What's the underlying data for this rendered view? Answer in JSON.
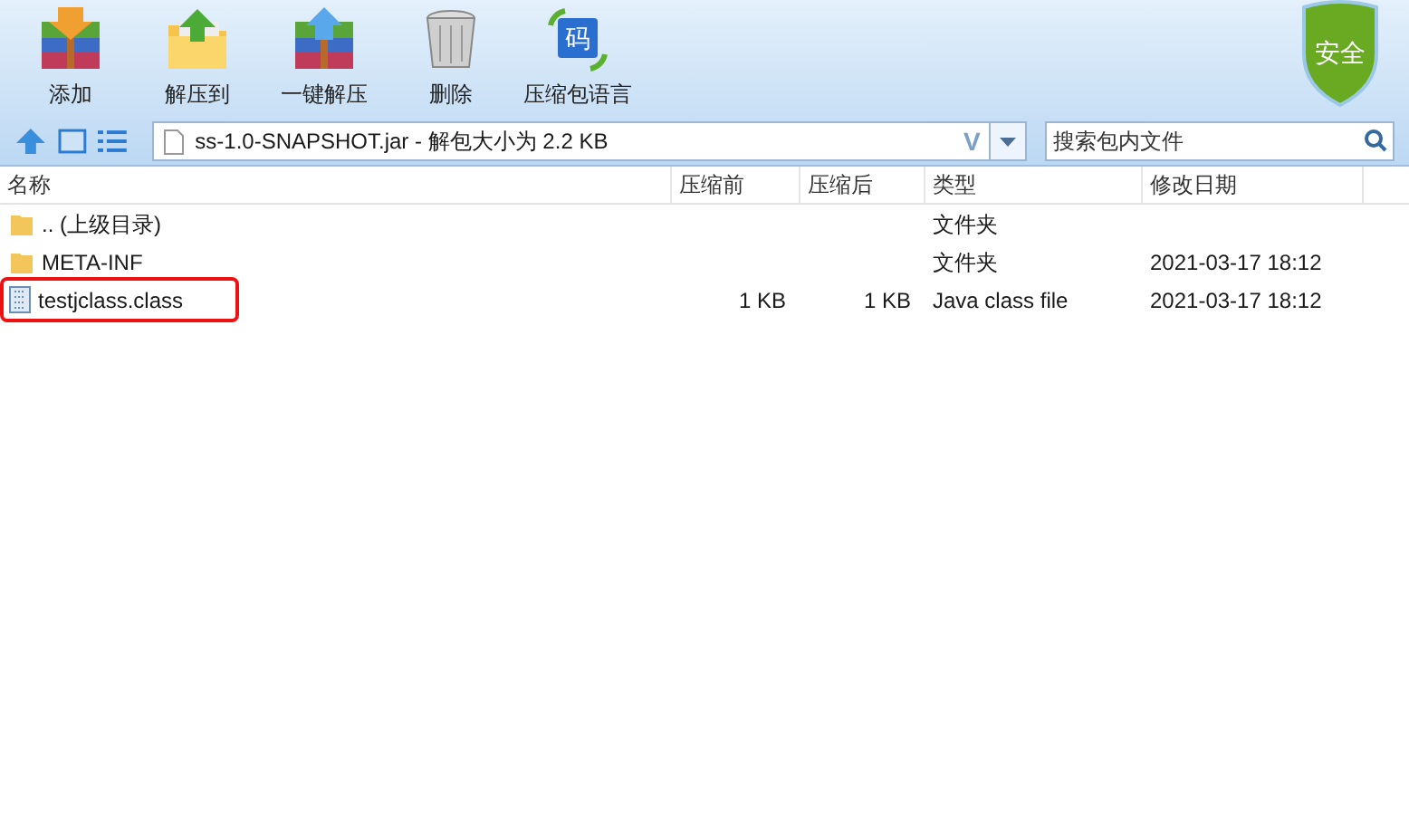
{
  "toolbar": [
    {
      "kind": "add",
      "label": "添加"
    },
    {
      "kind": "extract",
      "label": "解压到"
    },
    {
      "kind": "oneclick",
      "label": "一键解压"
    },
    {
      "kind": "delete",
      "label": "删除"
    },
    {
      "kind": "language",
      "label": "压缩包语言",
      "icon_text": "码"
    }
  ],
  "security_badge": "安全",
  "address": {
    "value": "ss-1.0-SNAPSHOT.jar - 解包大小为 2.2 KB",
    "arrow": "V"
  },
  "search": {
    "placeholder": "搜索包内文件"
  },
  "table": {
    "columns": [
      "名称",
      "压缩前",
      "压缩后",
      "类型",
      "修改日期"
    ],
    "rows": [
      {
        "kind": "folder",
        "name": ".. (上级目录)",
        "size": "",
        "packed": "",
        "type": "文件夹",
        "date": "",
        "highlighted": false
      },
      {
        "kind": "folder",
        "name": "META-INF",
        "size": "",
        "packed": "",
        "type": "文件夹",
        "date": "2021-03-17 18:12",
        "highlighted": false
      },
      {
        "kind": "file",
        "name": "testjclass.class",
        "size": "1 KB",
        "packed": "1 KB",
        "type": "Java class file",
        "date": "2021-03-17 18:12",
        "highlighted": true
      }
    ]
  }
}
